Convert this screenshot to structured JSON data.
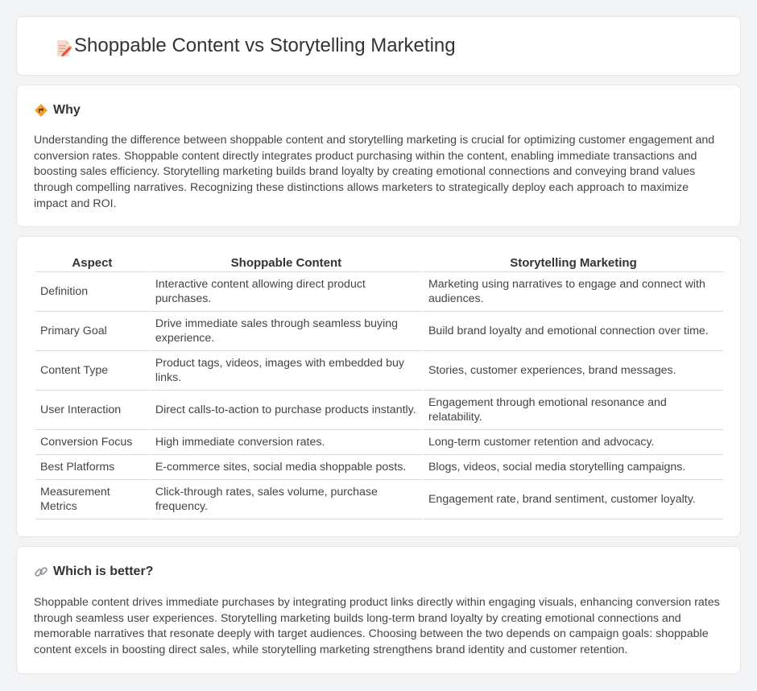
{
  "header": {
    "title": "Shoppable Content vs Storytelling Marketing",
    "icon": "document-pencil-icon"
  },
  "why": {
    "title": "Why",
    "icon": "diamond-signpost-icon",
    "text": "Understanding the difference between shoppable content and storytelling marketing is crucial for optimizing customer engagement and conversion rates. Shoppable content directly integrates product purchasing within the content, enabling immediate transactions and boosting sales efficiency. Storytelling marketing builds brand loyalty by creating emotional connections and conveying brand values through compelling narratives. Recognizing these distinctions allows marketers to strategically deploy each approach to maximize impact and ROI."
  },
  "table": {
    "headers": [
      "Aspect",
      "Shoppable Content",
      "Storytelling Marketing"
    ],
    "rows": [
      [
        "Definition",
        "Interactive content allowing direct product purchases.",
        "Marketing using narratives to engage and connect with audiences."
      ],
      [
        "Primary Goal",
        "Drive immediate sales through seamless buying experience.",
        "Build brand loyalty and emotional connection over time."
      ],
      [
        "Content Type",
        "Product tags, videos, images with embedded buy links.",
        "Stories, customer experiences, brand messages."
      ],
      [
        "User Interaction",
        "Direct calls-to-action to purchase products instantly.",
        "Engagement through emotional resonance and relatability."
      ],
      [
        "Conversion Focus",
        "High immediate conversion rates.",
        "Long-term customer retention and advocacy."
      ],
      [
        "Best Platforms",
        "E-commerce sites, social media shoppable posts.",
        "Blogs, videos, social media storytelling campaigns."
      ],
      [
        "Measurement Metrics",
        "Click-through rates, sales volume, purchase frequency.",
        "Engagement rate, brand sentiment, customer loyalty."
      ]
    ]
  },
  "better": {
    "title": "Which is better?",
    "icon": "link-icon",
    "text": "Shoppable content drives immediate purchases by integrating product links directly within engaging visuals, enhancing conversion rates through seamless user experiences. Storytelling marketing builds long-term brand loyalty by creating emotional connections and memorable narratives that resonate deeply with target audiences. Choosing between the two depends on campaign goals: shoppable content excels in boosting direct sales, while storytelling marketing strengthens brand identity and customer retention."
  },
  "colors": {
    "background": "#f2f3f5",
    "card": "#ffffff",
    "accent_orange": "#f0a030",
    "pencil_red": "#e2574c"
  }
}
